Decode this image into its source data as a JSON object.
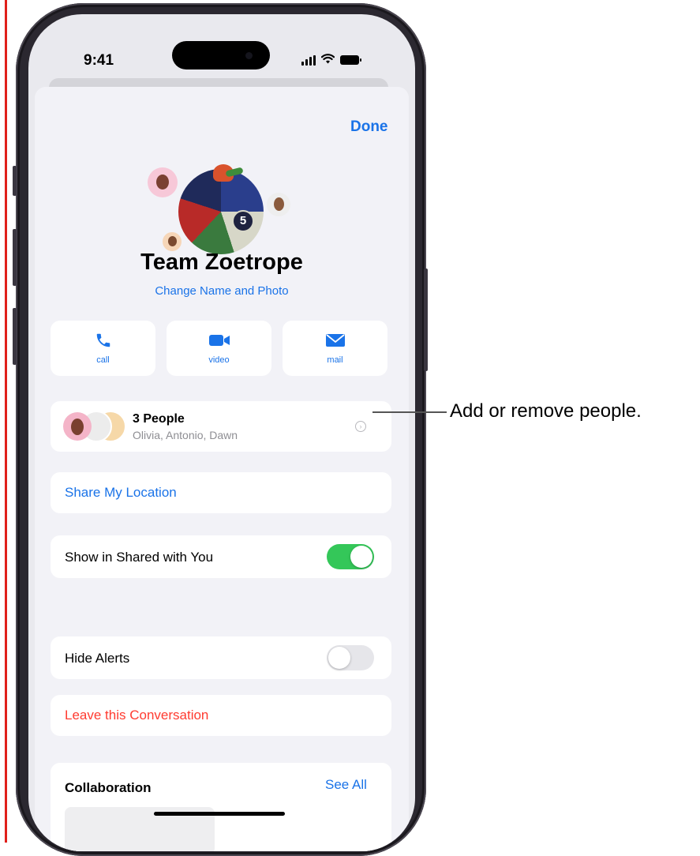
{
  "status_bar": {
    "time": "9:41"
  },
  "nav": {
    "done_label": "Done"
  },
  "group": {
    "badge_count": "5",
    "name": "Team Zoetrope",
    "change_link": "Change Name and Photo"
  },
  "actions": [
    {
      "label": "call",
      "icon": "phone-icon"
    },
    {
      "label": "video",
      "icon": "video-camera-icon"
    },
    {
      "label": "mail",
      "icon": "envelope-icon"
    }
  ],
  "people": {
    "title": "3 People",
    "names": "Olivia, Antonio, Dawn"
  },
  "share_location": {
    "label": "Share My Location"
  },
  "shared_with_you": {
    "label": "Show in Shared with You",
    "enabled": true
  },
  "hide_alerts": {
    "label": "Hide Alerts",
    "enabled": false
  },
  "leave": {
    "label": "Leave this Conversation"
  },
  "collaboration": {
    "title": "Collaboration",
    "see_all": "See All"
  },
  "callout": {
    "text": "Add or remove people."
  },
  "colors": {
    "accent": "#1a73e8",
    "destructive": "#ff3b30",
    "toggle_on": "#34c759",
    "guide_line": "#e0201b"
  }
}
